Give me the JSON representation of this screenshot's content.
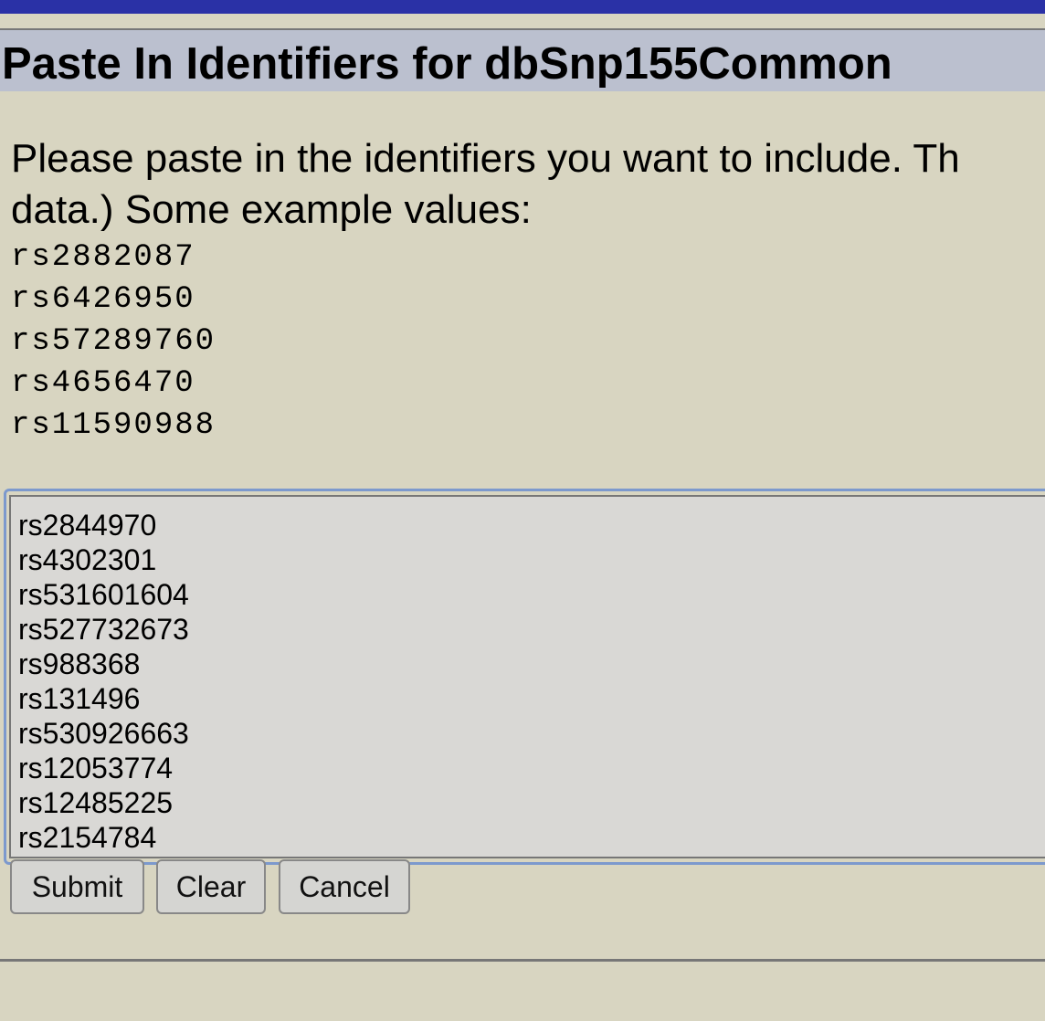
{
  "header": {
    "title": "Paste In Identifiers for dbSnp155Common"
  },
  "instructions": {
    "line1": "Please paste in the identifiers you want to include. Th",
    "line2": "data.) Some example values:"
  },
  "examples": [
    "rs2882087",
    "rs6426950",
    "rs57289760",
    "rs4656470",
    "rs11590988"
  ],
  "textarea": {
    "lines": [
      "rs2844970",
      "rs4302301",
      "rs531601604",
      "rs527732673",
      "rs988368",
      "rs131496",
      "rs530926663",
      "rs12053774",
      "rs12485225",
      "rs2154784"
    ]
  },
  "buttons": {
    "submit": "Submit",
    "clear": "Clear",
    "cancel": "Cancel"
  },
  "colors": {
    "top_bar": "#2a31a6",
    "title_bg": "#bbc0cf",
    "page_bg": "#d8d5c1",
    "focus_ring": "#7c99cd"
  }
}
